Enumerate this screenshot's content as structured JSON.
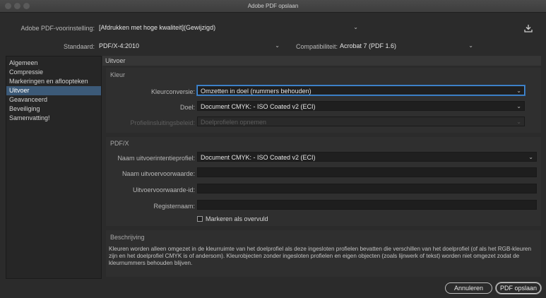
{
  "window": {
    "title": "Adobe PDF opslaan"
  },
  "header": {
    "preset_label": "Adobe PDF-voorinstelling:",
    "preset_value": "[Afdrukken met hoge kwaliteit](Gewijzigd)",
    "standard_label": "Standaard:",
    "standard_value": "PDF/X-4:2010",
    "compat_label": "Compatibiliteit:",
    "compat_value": "Acrobat 7 (PDF 1.6)"
  },
  "sidebar": {
    "items": [
      {
        "label": "Algemeen"
      },
      {
        "label": "Compressie"
      },
      {
        "label": "Markeringen en afloopteken"
      },
      {
        "label": "Uitvoer"
      },
      {
        "label": "Geavanceerd"
      },
      {
        "label": "Beveiliging"
      },
      {
        "label": "Samenvatting!"
      }
    ],
    "active_index": 3
  },
  "main": {
    "panel_title": "Uitvoer",
    "kleur": {
      "title": "Kleur",
      "conversion_label": "Kleurconversie:",
      "conversion_value": "Omzetten in doel (nummers behouden)",
      "target_label": "Doel:",
      "target_value": "Document CMYK:  - ISO Coated v2 (ECI)",
      "profile_label": "Profielinsluitingsbeleid:",
      "profile_value": "Doelprofielen opnemen"
    },
    "pdfx": {
      "title": "PDF/X",
      "intent_label": "Naam uitvoerintentieprofiel:",
      "intent_value": "Document CMYK:  - ISO Coated v2 (ECI)",
      "condition_name_label": "Naam uitvoervoorwaarde:",
      "condition_id_label": "Uitvoervoorwaarde-id:",
      "registry_label": "Registernaam:",
      "trapped_label": "Markeren als overvuld"
    },
    "description": {
      "title": "Beschrijving",
      "text": "Kleuren worden alleen omgezet in de kleurruimte van het doelprofiel als deze ingesloten profielen bevatten die verschillen van het doelprofiel (of als het RGB-kleuren zijn en het doelprofiel CMYK is of andersom). Kleurobjecten zonder ingesloten profielen en eigen objecten (zoals lijnwerk of tekst) worden niet omgezet zodat de kleurnummers behouden blijven."
    }
  },
  "footer": {
    "cancel_label": "Annuleren",
    "save_label": "PDF opslaan"
  },
  "colors": {
    "accent": "#3c5a78",
    "focus": "#4a90d9",
    "background": "#2b2b2b"
  }
}
